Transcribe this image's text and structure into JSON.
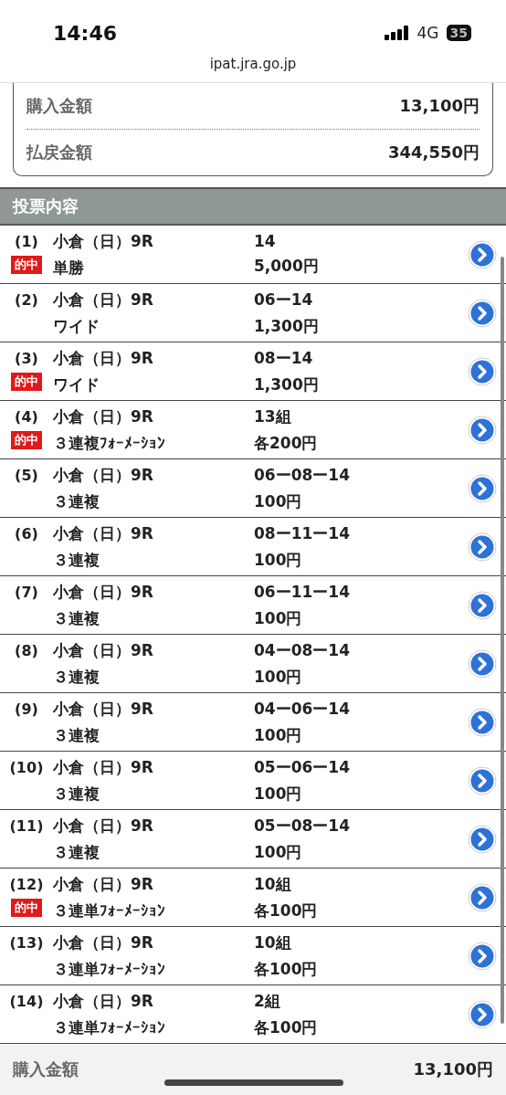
{
  "status_bar": {
    "time": "14:46",
    "network": "4G",
    "battery": "35"
  },
  "url": "ipat.jra.go.jp",
  "summary": [
    {
      "label": "購入金額",
      "value": "13,100円"
    },
    {
      "label": "払戻金額",
      "value": "344,550円"
    }
  ],
  "section_title": "投票内容",
  "bets": [
    {
      "no": "(1)",
      "race": "小倉（日）9R",
      "type": "単勝",
      "numbers": "14",
      "amount": "5,000円",
      "hit": true,
      "hit_label": "的中"
    },
    {
      "no": "(2)",
      "race": "小倉（日）9R",
      "type": "ワイド",
      "numbers": "06ー14",
      "amount": "1,300円",
      "hit": false
    },
    {
      "no": "(3)",
      "race": "小倉（日）9R",
      "type": "ワイド",
      "numbers": "08ー14",
      "amount": "1,300円",
      "hit": true,
      "hit_label": "的中"
    },
    {
      "no": "(4)",
      "race": "小倉（日）9R",
      "type": "３連複ﾌｫｰﾒｰｼｮﾝ",
      "numbers": "13組",
      "amount": "各200円",
      "hit": true,
      "hit_label": "的中"
    },
    {
      "no": "(5)",
      "race": "小倉（日）9R",
      "type": "３連複",
      "numbers": "06ー08ー14",
      "amount": "100円",
      "hit": false
    },
    {
      "no": "(6)",
      "race": "小倉（日）9R",
      "type": "３連複",
      "numbers": "08ー11ー14",
      "amount": "100円",
      "hit": false
    },
    {
      "no": "(7)",
      "race": "小倉（日）9R",
      "type": "３連複",
      "numbers": "06ー11ー14",
      "amount": "100円",
      "hit": false
    },
    {
      "no": "(8)",
      "race": "小倉（日）9R",
      "type": "３連複",
      "numbers": "04ー08ー14",
      "amount": "100円",
      "hit": false
    },
    {
      "no": "(9)",
      "race": "小倉（日）9R",
      "type": "３連複",
      "numbers": "04ー06ー14",
      "amount": "100円",
      "hit": false
    },
    {
      "no": "(10)",
      "race": "小倉（日）9R",
      "type": "３連複",
      "numbers": "05ー06ー14",
      "amount": "100円",
      "hit": false
    },
    {
      "no": "(11)",
      "race": "小倉（日）9R",
      "type": "３連複",
      "numbers": "05ー08ー14",
      "amount": "100円",
      "hit": false
    },
    {
      "no": "(12)",
      "race": "小倉（日）9R",
      "type": "３連単ﾌｫｰﾒｰｼｮﾝ",
      "numbers": "10組",
      "amount": "各100円",
      "hit": true,
      "hit_label": "的中"
    },
    {
      "no": "(13)",
      "race": "小倉（日）9R",
      "type": "３連単ﾌｫｰﾒｰｼｮﾝ",
      "numbers": "10組",
      "amount": "各100円",
      "hit": false
    },
    {
      "no": "(14)",
      "race": "小倉（日）9R",
      "type": "３連単ﾌｫｰﾒｰｼｮﾝ",
      "numbers": "2組",
      "amount": "各100円",
      "hit": false
    }
  ],
  "footer": {
    "label": "購入金額",
    "value": "13,100円"
  }
}
